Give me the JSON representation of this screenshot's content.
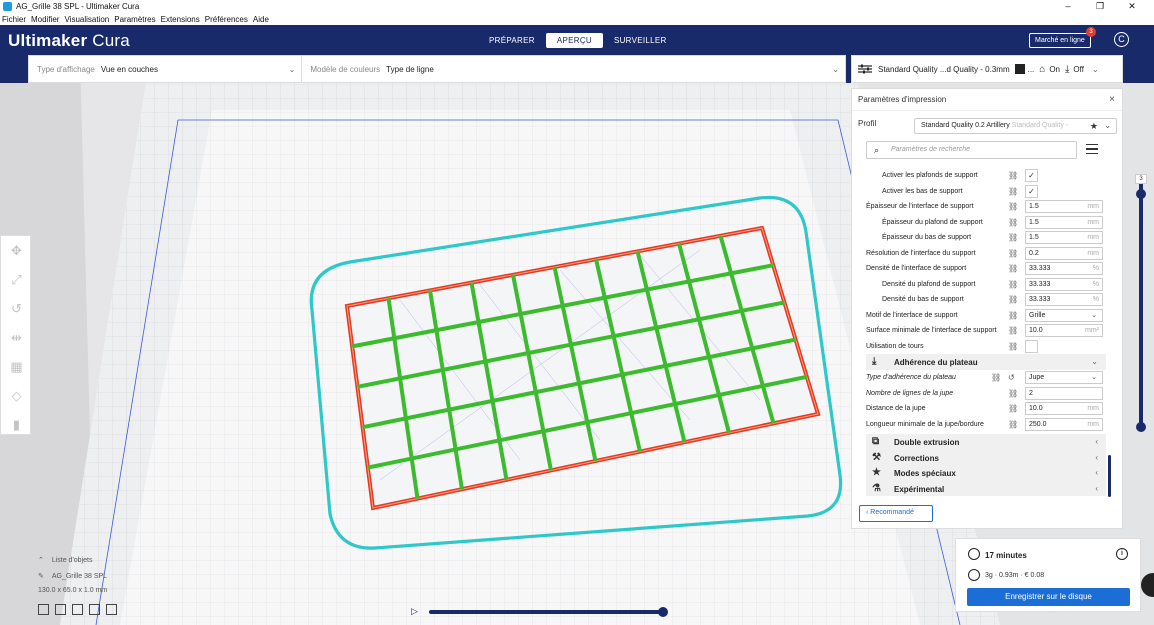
{
  "window": {
    "title": "AG_Grille 38 SPL - Ultimaker Cura",
    "controls": [
      "–",
      "❐",
      "✕"
    ]
  },
  "menu": [
    "Fichier",
    "Modifier",
    "Visualisation",
    "Paramètres",
    "Extensions",
    "Préférences",
    "Aide"
  ],
  "header": {
    "brand_bold": "Ultimaker",
    "brand_light": "Cura",
    "stages": [
      "PRÉPARER",
      "APERÇU",
      "SURVEILLER"
    ],
    "active_stage": "APERÇU",
    "marketplace": "Marché en ligne",
    "marketplace_badge": "3",
    "account_icon": "C"
  },
  "viewbar": {
    "view_type_label": "Type d'affichage",
    "view_type_value": "Vue en couches",
    "color_scheme_label": "Modèle de couleurs",
    "color_scheme_value": "Type de ligne"
  },
  "print_settings_bar": {
    "profile": "Standard Quality ...d Quality - 0.3mm",
    "support_value": "...",
    "adhesion_value": "On",
    "extra_value": "Off"
  },
  "panel": {
    "title": "Paramètres d'impression",
    "profile_label": "Profil",
    "profile_value": "Standard Quality 0.2 Artillery",
    "profile_hint": "Standard Quality -",
    "search_placeholder": "Paramètres de recherche",
    "settings": [
      {
        "label": "Activer les plafonds de support",
        "indent": true,
        "type": "check",
        "value": "✓"
      },
      {
        "label": "Activer les bas de support",
        "indent": true,
        "type": "check",
        "value": "✓"
      },
      {
        "label": "Épaisseur de l'interface de support",
        "indent": false,
        "type": "field",
        "value": "1.5",
        "unit": "mm"
      },
      {
        "label": "Épaisseur du plafond de support",
        "indent": true,
        "type": "field",
        "value": "1.5",
        "unit": "mm"
      },
      {
        "label": "Épaisseur du bas de support",
        "indent": true,
        "type": "field",
        "value": "1.5",
        "unit": "mm"
      },
      {
        "label": "Résolution de l'interface du support",
        "indent": false,
        "type": "field",
        "value": "0.2",
        "unit": "mm"
      },
      {
        "label": "Densité de l'interface de support",
        "indent": false,
        "type": "field",
        "value": "33.333",
        "unit": "%"
      },
      {
        "label": "Densité du plafond de support",
        "indent": true,
        "type": "field",
        "value": "33.333",
        "unit": "%"
      },
      {
        "label": "Densité du bas de support",
        "indent": true,
        "type": "field",
        "value": "33.333",
        "unit": "%"
      },
      {
        "label": "Motif de l'interface de support",
        "indent": false,
        "type": "select",
        "value": "Grille"
      },
      {
        "label": "Surface minimale de l'interface de support",
        "indent": false,
        "type": "field",
        "value": "10.0",
        "unit": "mm²"
      },
      {
        "label": "Utilisation de tours",
        "indent": false,
        "type": "check",
        "value": ""
      }
    ],
    "adhesion_category": "Adhérence du plateau",
    "adhesion_settings": [
      {
        "label": "Type d'adhérence du plateau",
        "italic": true,
        "type": "select",
        "value": "Jupe",
        "reset": true
      },
      {
        "label": "Nombre de lignes de la jupe",
        "italic": true,
        "type": "field",
        "value": "2",
        "unit": ""
      },
      {
        "label": "Distance de la jupe",
        "italic": false,
        "type": "field",
        "value": "10.0",
        "unit": "mm"
      },
      {
        "label": "Longueur minimale de la jupe/bordure",
        "italic": false,
        "type": "field",
        "value": "250.0",
        "unit": "mm"
      }
    ],
    "categories": [
      "Double extrusion",
      "Corrections",
      "Modes spéciaux",
      "Expérimental"
    ],
    "recommended_button": "Recommandé"
  },
  "layer_slider": {
    "max_layer": "3"
  },
  "object_list": {
    "header": "Liste d'objets",
    "object_name": "AG_Grille 38 SPL",
    "dimensions": "130.0 x 65.0 x 1.0 mm"
  },
  "estimate": {
    "time": "17 minutes",
    "material": "3g · 0.93m · € 0.08",
    "save_button": "Enregistrer sur le disque"
  },
  "colors": {
    "header_bg": "#192a6b",
    "accent": "#1b6ed6",
    "skirt": "#2ec8c8",
    "wall_outer": "#e53a20",
    "wall_inner": "#3dbb2e"
  }
}
